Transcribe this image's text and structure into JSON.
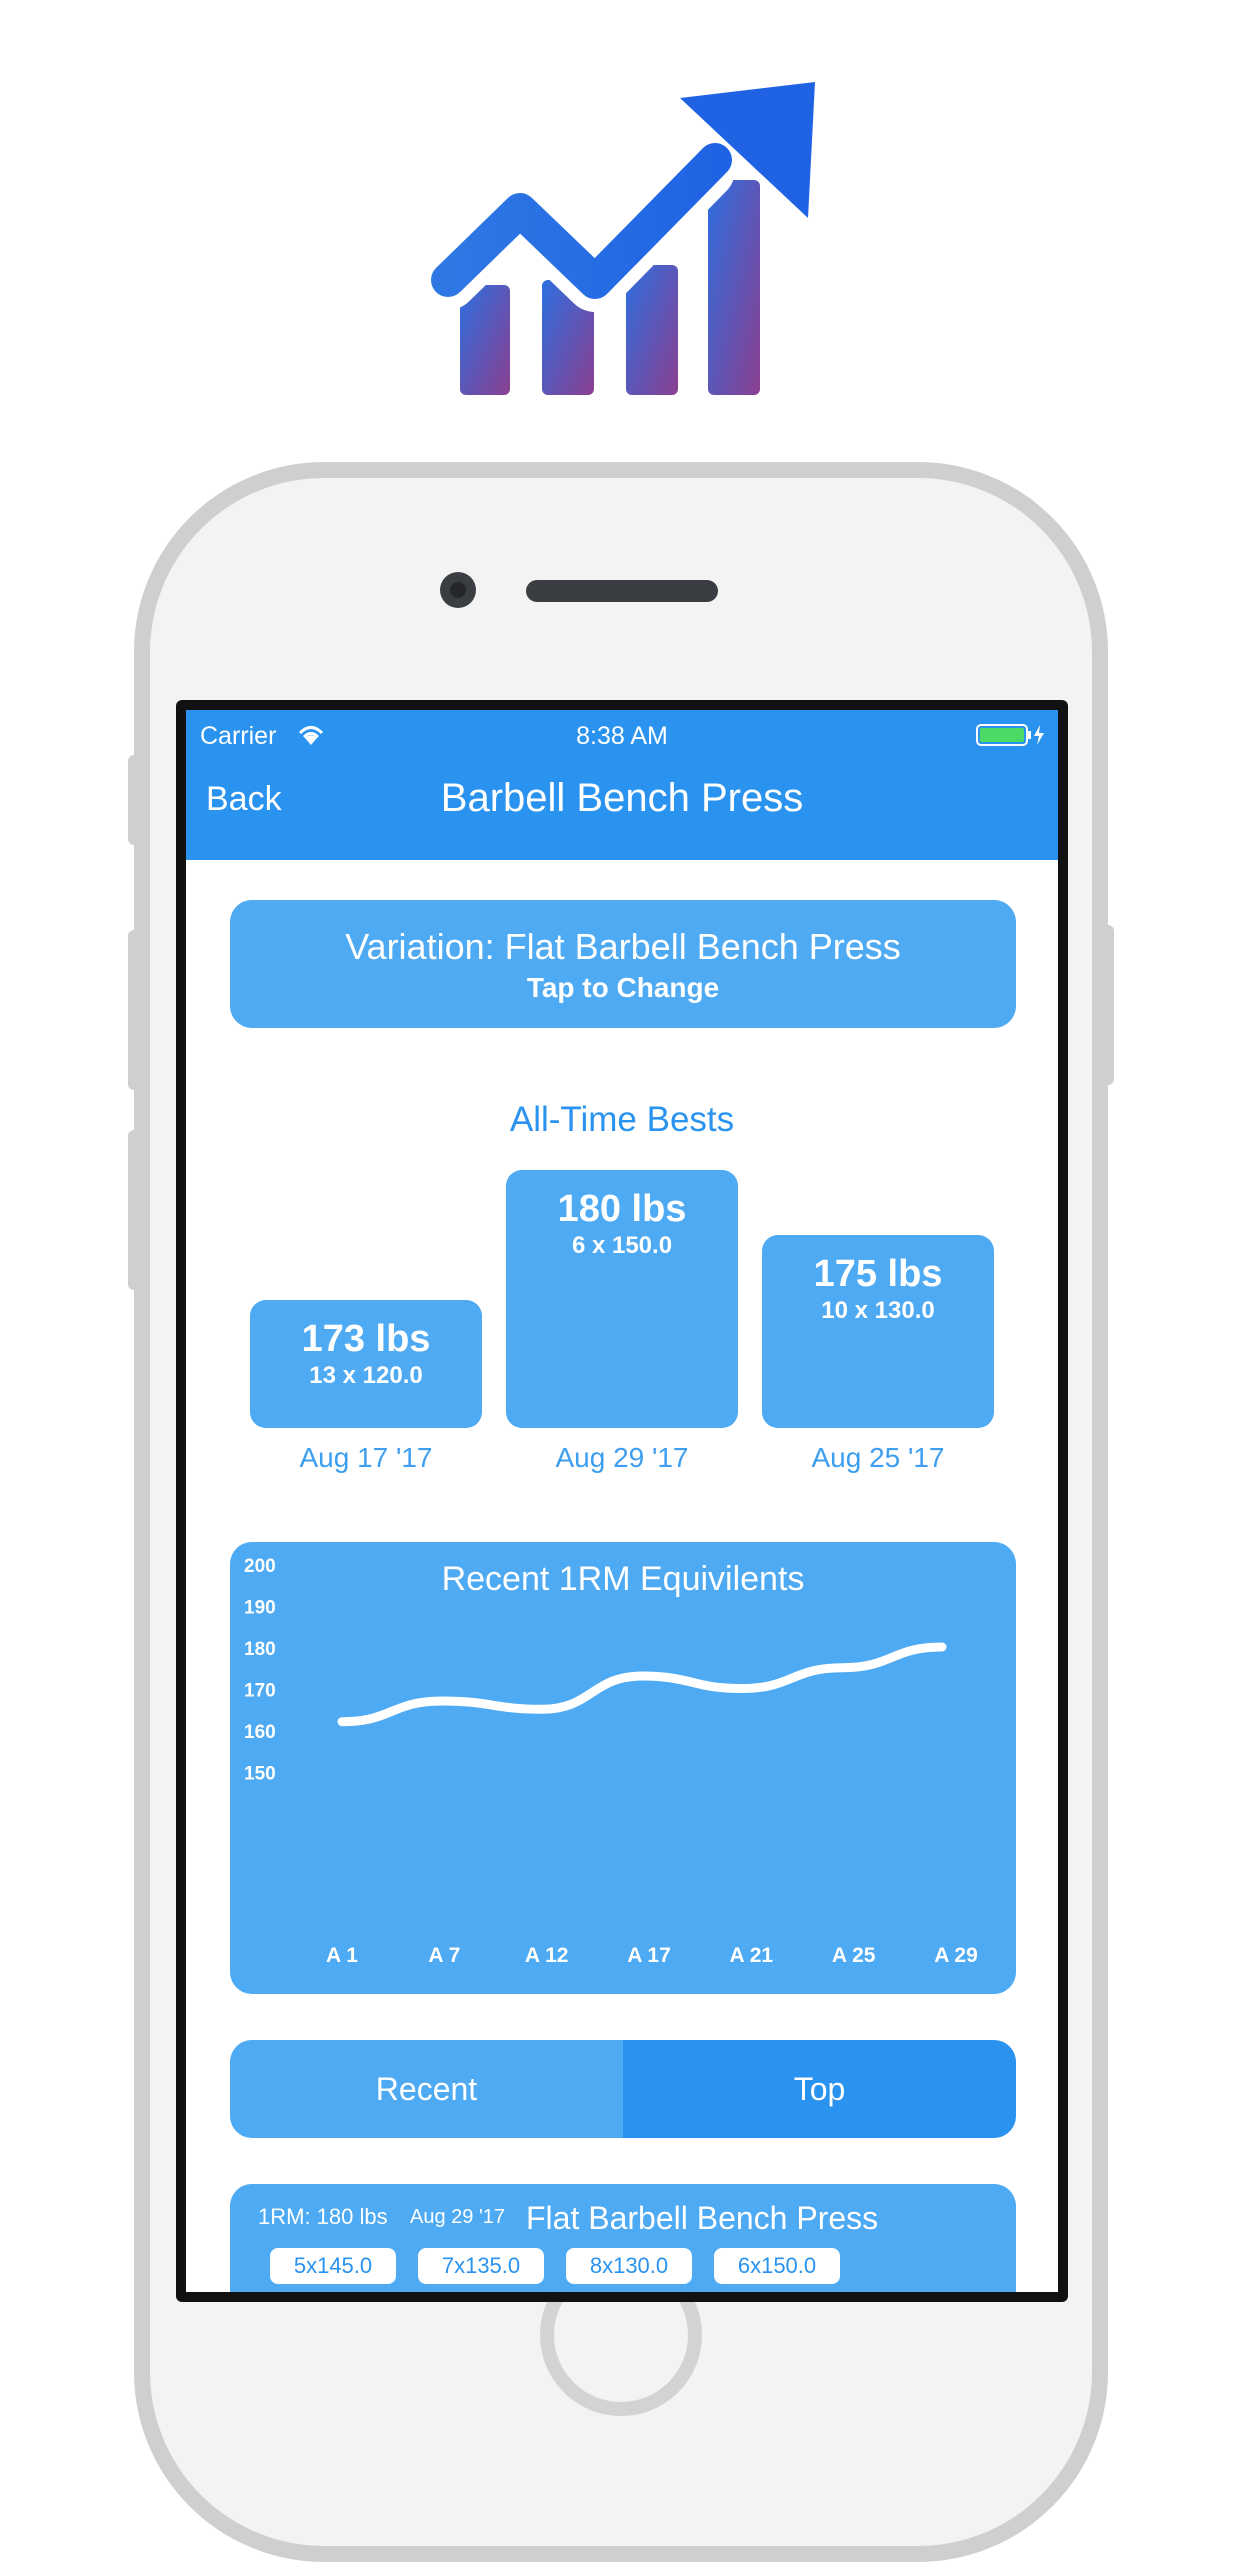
{
  "status_bar": {
    "carrier": "Carrier",
    "time": "8:38 AM"
  },
  "nav": {
    "back_label": "Back",
    "title": "Barbell Bench Press"
  },
  "variation": {
    "label": "Variation: Flat Barbell Bench Press",
    "sub": "Tap to Change"
  },
  "bests": {
    "title": "All-Time Bests",
    "items": [
      {
        "weight": "173 lbs",
        "detail": "13 x 120.0",
        "date": "Aug 17 '17"
      },
      {
        "weight": "180 lbs",
        "detail": "6 x 150.0",
        "date": "Aug 29 '17"
      },
      {
        "weight": "175 lbs",
        "detail": "10 x 130.0",
        "date": "Aug 25 '17"
      }
    ]
  },
  "chart_data": {
    "type": "line",
    "title": "Recent 1RM Equivilents",
    "x": [
      "A 1",
      "A 7",
      "A 12",
      "A 17",
      "A 21",
      "A 25",
      "A 29"
    ],
    "yticks": [
      200,
      190,
      180,
      170,
      160,
      150
    ],
    "ylim": [
      145,
      200
    ],
    "series": [
      {
        "values": [
          162,
          167,
          165,
          173,
          170,
          175,
          180
        ]
      }
    ],
    "grid": false
  },
  "segment": {
    "recent_label": "Recent",
    "top_label": "Top",
    "selected": "Top"
  },
  "entry": {
    "one_rm": "1RM: 180 lbs",
    "date": "Aug 29 '17",
    "name": "Flat Barbell Bench Press",
    "sets": [
      "5x145.0",
      "7x135.0",
      "8x130.0",
      "6x150.0"
    ]
  },
  "colors": {
    "nav_blue": "#2a93ef",
    "card_blue": "#4eaaf3"
  }
}
